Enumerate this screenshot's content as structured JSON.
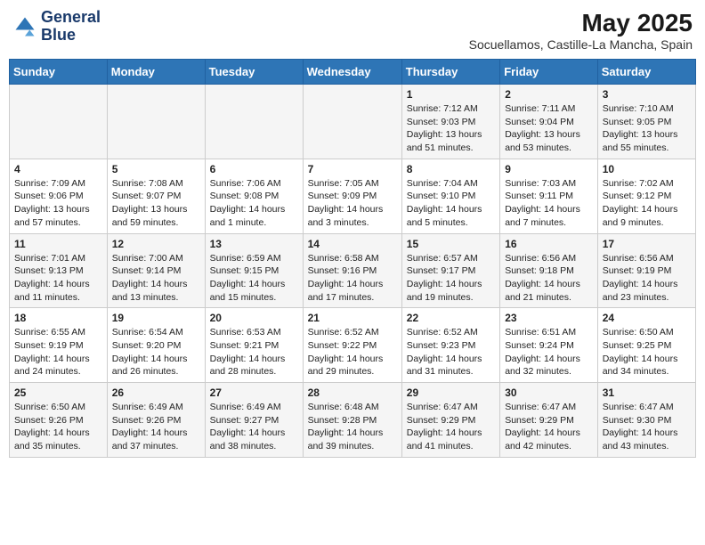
{
  "logo": {
    "line1": "General",
    "line2": "Blue"
  },
  "title": "May 2025",
  "subtitle": "Socuellamos, Castille-La Mancha, Spain",
  "days_of_week": [
    "Sunday",
    "Monday",
    "Tuesday",
    "Wednesday",
    "Thursday",
    "Friday",
    "Saturday"
  ],
  "weeks": [
    [
      {
        "day": "",
        "info": ""
      },
      {
        "day": "",
        "info": ""
      },
      {
        "day": "",
        "info": ""
      },
      {
        "day": "",
        "info": ""
      },
      {
        "day": "1",
        "info": "Sunrise: 7:12 AM\nSunset: 9:03 PM\nDaylight: 13 hours\nand 51 minutes."
      },
      {
        "day": "2",
        "info": "Sunrise: 7:11 AM\nSunset: 9:04 PM\nDaylight: 13 hours\nand 53 minutes."
      },
      {
        "day": "3",
        "info": "Sunrise: 7:10 AM\nSunset: 9:05 PM\nDaylight: 13 hours\nand 55 minutes."
      }
    ],
    [
      {
        "day": "4",
        "info": "Sunrise: 7:09 AM\nSunset: 9:06 PM\nDaylight: 13 hours\nand 57 minutes."
      },
      {
        "day": "5",
        "info": "Sunrise: 7:08 AM\nSunset: 9:07 PM\nDaylight: 13 hours\nand 59 minutes."
      },
      {
        "day": "6",
        "info": "Sunrise: 7:06 AM\nSunset: 9:08 PM\nDaylight: 14 hours\nand 1 minute."
      },
      {
        "day": "7",
        "info": "Sunrise: 7:05 AM\nSunset: 9:09 PM\nDaylight: 14 hours\nand 3 minutes."
      },
      {
        "day": "8",
        "info": "Sunrise: 7:04 AM\nSunset: 9:10 PM\nDaylight: 14 hours\nand 5 minutes."
      },
      {
        "day": "9",
        "info": "Sunrise: 7:03 AM\nSunset: 9:11 PM\nDaylight: 14 hours\nand 7 minutes."
      },
      {
        "day": "10",
        "info": "Sunrise: 7:02 AM\nSunset: 9:12 PM\nDaylight: 14 hours\nand 9 minutes."
      }
    ],
    [
      {
        "day": "11",
        "info": "Sunrise: 7:01 AM\nSunset: 9:13 PM\nDaylight: 14 hours\nand 11 minutes."
      },
      {
        "day": "12",
        "info": "Sunrise: 7:00 AM\nSunset: 9:14 PM\nDaylight: 14 hours\nand 13 minutes."
      },
      {
        "day": "13",
        "info": "Sunrise: 6:59 AM\nSunset: 9:15 PM\nDaylight: 14 hours\nand 15 minutes."
      },
      {
        "day": "14",
        "info": "Sunrise: 6:58 AM\nSunset: 9:16 PM\nDaylight: 14 hours\nand 17 minutes."
      },
      {
        "day": "15",
        "info": "Sunrise: 6:57 AM\nSunset: 9:17 PM\nDaylight: 14 hours\nand 19 minutes."
      },
      {
        "day": "16",
        "info": "Sunrise: 6:56 AM\nSunset: 9:18 PM\nDaylight: 14 hours\nand 21 minutes."
      },
      {
        "day": "17",
        "info": "Sunrise: 6:56 AM\nSunset: 9:19 PM\nDaylight: 14 hours\nand 23 minutes."
      }
    ],
    [
      {
        "day": "18",
        "info": "Sunrise: 6:55 AM\nSunset: 9:19 PM\nDaylight: 14 hours\nand 24 minutes."
      },
      {
        "day": "19",
        "info": "Sunrise: 6:54 AM\nSunset: 9:20 PM\nDaylight: 14 hours\nand 26 minutes."
      },
      {
        "day": "20",
        "info": "Sunrise: 6:53 AM\nSunset: 9:21 PM\nDaylight: 14 hours\nand 28 minutes."
      },
      {
        "day": "21",
        "info": "Sunrise: 6:52 AM\nSunset: 9:22 PM\nDaylight: 14 hours\nand 29 minutes."
      },
      {
        "day": "22",
        "info": "Sunrise: 6:52 AM\nSunset: 9:23 PM\nDaylight: 14 hours\nand 31 minutes."
      },
      {
        "day": "23",
        "info": "Sunrise: 6:51 AM\nSunset: 9:24 PM\nDaylight: 14 hours\nand 32 minutes."
      },
      {
        "day": "24",
        "info": "Sunrise: 6:50 AM\nSunset: 9:25 PM\nDaylight: 14 hours\nand 34 minutes."
      }
    ],
    [
      {
        "day": "25",
        "info": "Sunrise: 6:50 AM\nSunset: 9:26 PM\nDaylight: 14 hours\nand 35 minutes."
      },
      {
        "day": "26",
        "info": "Sunrise: 6:49 AM\nSunset: 9:26 PM\nDaylight: 14 hours\nand 37 minutes."
      },
      {
        "day": "27",
        "info": "Sunrise: 6:49 AM\nSunset: 9:27 PM\nDaylight: 14 hours\nand 38 minutes."
      },
      {
        "day": "28",
        "info": "Sunrise: 6:48 AM\nSunset: 9:28 PM\nDaylight: 14 hours\nand 39 minutes."
      },
      {
        "day": "29",
        "info": "Sunrise: 6:47 AM\nSunset: 9:29 PM\nDaylight: 14 hours\nand 41 minutes."
      },
      {
        "day": "30",
        "info": "Sunrise: 6:47 AM\nSunset: 9:29 PM\nDaylight: 14 hours\nand 42 minutes."
      },
      {
        "day": "31",
        "info": "Sunrise: 6:47 AM\nSunset: 9:30 PM\nDaylight: 14 hours\nand 43 minutes."
      }
    ]
  ]
}
